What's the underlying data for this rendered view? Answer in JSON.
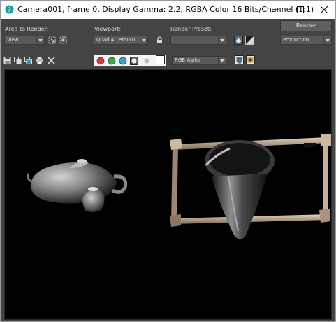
{
  "window": {
    "title": "Camera001, frame 0, Display Gamma: 2.2, RGBA Color 16 Bits/Channel (1:1)"
  },
  "panel": {
    "area_to_render_label": "Area to Render:",
    "area_to_render_value": "View",
    "viewport_label": "Viewport:",
    "viewport_value": "Quad 4...era001",
    "render_preset_label": "Render Preset:",
    "render_preset_value": "",
    "render_button_label": "Render",
    "production_value": "Production"
  },
  "toolbar": {
    "channel_display_value": "RGB Alpha"
  },
  "colors": {
    "channel_red": "#d83a3a",
    "channel_green": "#3aa84a",
    "channel_blue": "#2fa8d8",
    "panel_bg": "#444444",
    "render_bg": "#000000"
  },
  "icons": [
    "app-3ds-icon",
    "minimize-icon",
    "maximize-icon",
    "close-icon",
    "region-icon",
    "auto-region-icon",
    "lock-icon",
    "preset-teapot-icon",
    "environment-icon",
    "save-image-icon",
    "copy-image-icon",
    "clone-window-icon",
    "print-image-icon",
    "clear-icon",
    "red-channel-icon",
    "green-channel-icon",
    "blue-channel-icon",
    "alpha-channel-icon",
    "monochrome-icon",
    "swatch-icon",
    "display-toggle-icon",
    "display-frame-icon"
  ]
}
